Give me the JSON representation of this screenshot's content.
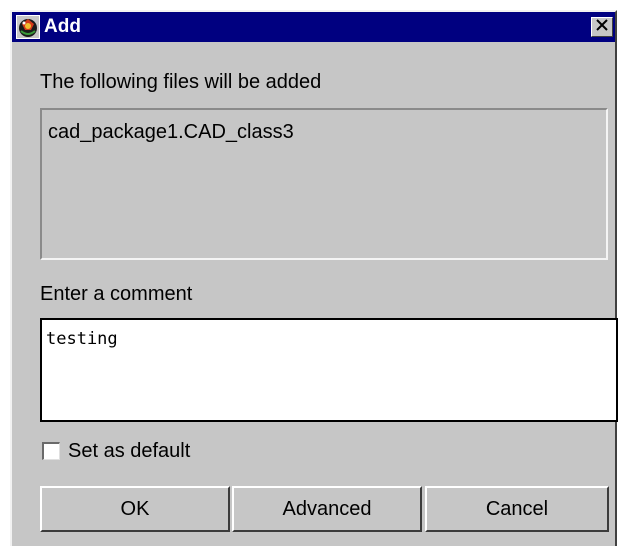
{
  "window": {
    "title": "Add",
    "app_icon": "app-globe-icon",
    "close_icon": "close-icon"
  },
  "files_section": {
    "label": "The following files will be added",
    "items": [
      "cad_package1.CAD_class3"
    ]
  },
  "comment_section": {
    "label": "Enter a comment",
    "value": "testing",
    "placeholder": ""
  },
  "set_default": {
    "label": "Set as default",
    "checked": false
  },
  "buttons": {
    "ok": "OK",
    "advanced": "Advanced",
    "cancel": "Cancel"
  },
  "colors": {
    "titlebar": "#000080",
    "dialog_bg": "#c6c6c6",
    "field_bg": "#ffffff"
  }
}
